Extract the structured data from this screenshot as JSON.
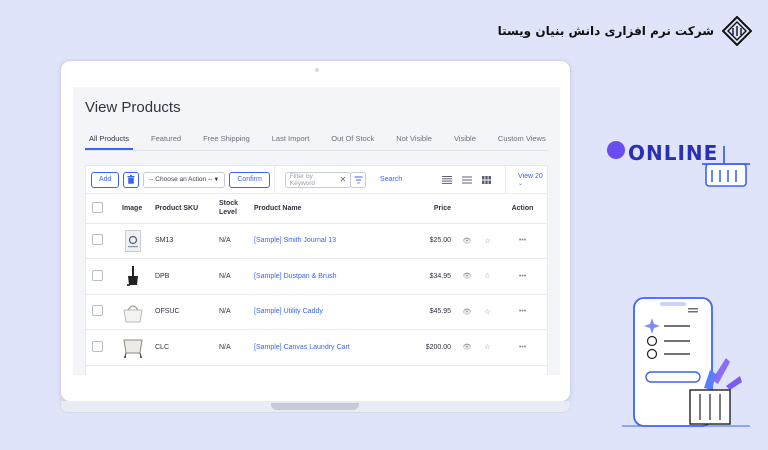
{
  "company": {
    "name": "شرکت نرم افزاری دانش بنیان ویستا"
  },
  "page": {
    "title": "View Products"
  },
  "tabs": [
    {
      "label": "All Products",
      "active": true
    },
    {
      "label": "Featured"
    },
    {
      "label": "Free Shipping"
    },
    {
      "label": "Last Import"
    },
    {
      "label": "Out Of Stock"
    },
    {
      "label": "Not Visible"
    },
    {
      "label": "Visible"
    },
    {
      "label": "Custom Views"
    }
  ],
  "toolbar": {
    "add_label": "Add",
    "action_select": "-- Choose an Action --",
    "confirm_label": "Confirm",
    "filter_placeholder": "Filter by Keyword",
    "search_label": "Search",
    "view_count": "View 20"
  },
  "table": {
    "headers": {
      "image": "Image",
      "sku": "Product SKU",
      "stock": "Stock Level",
      "name": "Product Name",
      "price": "Price",
      "action": "Action"
    },
    "rows": [
      {
        "sku": "SM13",
        "stock": "N/A",
        "name": "[Sample] Smith Journal 13",
        "price": "$25.00",
        "image_icon": "journal-icon"
      },
      {
        "sku": "DPB",
        "stock": "N/A",
        "name": "[Sample] Dustpan & Brush",
        "price": "$34.95",
        "image_icon": "dustpan-icon"
      },
      {
        "sku": "OFSUC",
        "stock": "N/A",
        "name": "[Sample] Utility Caddy",
        "price": "$45.95",
        "image_icon": "caddy-icon"
      },
      {
        "sku": "CLC",
        "stock": "N/A",
        "name": "[Sample] Canvas Laundry Cart",
        "price": "$200.00",
        "image_icon": "laundry-cart-icon"
      }
    ],
    "more_glyph": "•••"
  },
  "illustration": {
    "online_text": "ONLINE"
  },
  "colors": {
    "accent": "#3c64f4",
    "background": "#dfe4fb",
    "online_purple": "#6b4cf0"
  }
}
